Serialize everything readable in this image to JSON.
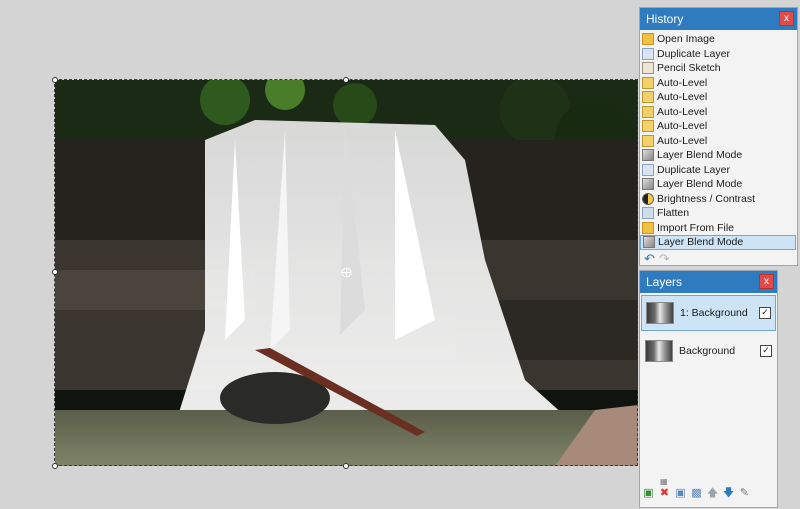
{
  "history": {
    "title": "History",
    "close_label": "x",
    "items": [
      {
        "label": "Open Image",
        "icon": "folder-open-icon"
      },
      {
        "label": "Duplicate Layer",
        "icon": "duplicate-layer-icon"
      },
      {
        "label": "Pencil Sketch",
        "icon": "pencil-sketch-icon"
      },
      {
        "label": "Auto-Level",
        "icon": "auto-level-icon"
      },
      {
        "label": "Auto-Level",
        "icon": "auto-level-icon"
      },
      {
        "label": "Auto-Level",
        "icon": "auto-level-icon"
      },
      {
        "label": "Auto-Level",
        "icon": "auto-level-icon"
      },
      {
        "label": "Auto-Level",
        "icon": "auto-level-icon"
      },
      {
        "label": "Layer Blend Mode",
        "icon": "layer-blend-icon"
      },
      {
        "label": "Duplicate Layer",
        "icon": "duplicate-layer-icon"
      },
      {
        "label": "Layer Blend Mode",
        "icon": "layer-blend-icon"
      },
      {
        "label": "Brightness / Contrast",
        "icon": "brightness-contrast-icon"
      },
      {
        "label": "Flatten",
        "icon": "flatten-icon"
      },
      {
        "label": "Import From File",
        "icon": "import-file-icon"
      },
      {
        "label": "Layer Blend Mode",
        "icon": "layer-blend-icon"
      }
    ],
    "selected_index": 14,
    "undo_icon": "undo-icon",
    "redo_icon": "redo-icon"
  },
  "layers": {
    "title": "Layers",
    "close_label": "x",
    "items": [
      {
        "name": "1: Background",
        "visible": true,
        "selected": true
      },
      {
        "name": "Background",
        "visible": true,
        "selected": false
      }
    ],
    "toolbar": [
      "add-layer-icon",
      "delete-layer-icon",
      "duplicate-layer-icon",
      "merge-down-icon",
      "move-up-icon",
      "move-down-icon",
      "layer-properties-icon"
    ]
  },
  "colors": {
    "accent": "#2e7bc0",
    "close": "#e14b47",
    "selection": "#cde3f6"
  }
}
